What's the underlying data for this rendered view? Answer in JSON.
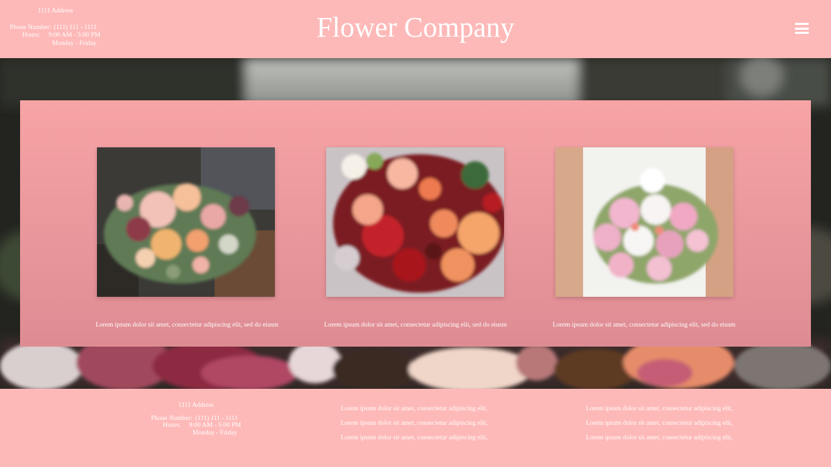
{
  "header": {
    "address": "1111 Address",
    "phone_label": "Phone Number:",
    "phone": "(111) 111 - 1111",
    "hours_label": "Hours:",
    "hours": "9:00 AM - 5:00 PM",
    "days": "Monday - Friday",
    "title": "Flower Company",
    "menu_icon": "hamburger-menu-icon"
  },
  "gallery": [
    {
      "image": "flower-arrangement-box",
      "caption": "Lorem ipsum dolor sit amet, consectetur adipiscing elit, sed do eiusm"
    },
    {
      "image": "red-orange-rose-bouquet",
      "caption": "Lorem ipsum dolor sit amet, consectetur adipiscing elit, sed do eiusm"
    },
    {
      "image": "pink-bridal-bouquet",
      "caption": "Lorem ipsum dolor sit amet, consectetur adipiscing elit, sed do eiusm"
    }
  ],
  "footer": {
    "address": "1111 Address",
    "phone_label": "Phone Number:",
    "phone": "(111) 111 - 1111",
    "hours_label": "Hours:",
    "hours": "9:00 AM - 5:00 PM",
    "days": "Monday - Friday",
    "col2": [
      "Lorem ipsum dolor sit amet, consectetur adipiscing elit,",
      "Lorem ipsum dolor sit amet, consectetur adipiscing elit,",
      "Lorem ipsum dolor sit amet, consectetur adipiscing elit,"
    ],
    "col3": [
      "Lorem ipsum dolor sit amet, consectetur adipiscing elit,",
      "Lorem ipsum dolor sit amet, consectetur adipiscing elit,",
      "Lorem ipsum dolor sit amet, consectetur adipiscing elit,"
    ]
  },
  "colors": {
    "header_pink": "#fdb9b8",
    "panel_pink_top": "#f7a4a6",
    "panel_pink_bottom": "#de8c93",
    "text": "#ffffff"
  }
}
